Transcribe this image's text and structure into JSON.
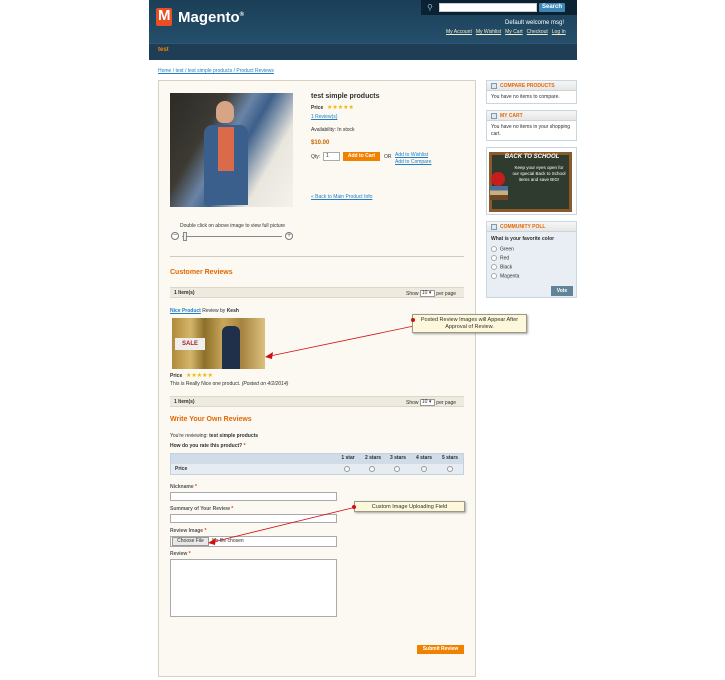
{
  "header": {
    "logo_letter": "M",
    "logo_text": "Magento",
    "logo_mark": "®",
    "search_button": "Search",
    "welcome": "Default welcome msg!",
    "links": [
      "My Account",
      "My Wishlist",
      "My Cart",
      "Checkout",
      "Log In"
    ],
    "nav_item": "test"
  },
  "breadcrumb": "Home / test / test simple products / Product Reviews",
  "product": {
    "name": "test simple products",
    "price_label": "Price",
    "stars": "★★★★★",
    "reviews_link": "1 Review(s)",
    "availability": "Availability: In stock",
    "price": "$10.00",
    "qty_label": "Qty:",
    "qty_value": "1",
    "add_to_cart": "Add to Cart",
    "or": "OR",
    "wishlist": "Add to Wishlist",
    "compare": "Add to Compare",
    "back_link": "« Back to Main Product Info",
    "zoom_hint": "Double click on above image to view full picture",
    "zoom_minus": "−",
    "zoom_plus": "+"
  },
  "reviews": {
    "title": "Customer Reviews",
    "items": "1 Item(s)",
    "show_label": "Show",
    "per_page_value": "10 ▾",
    "per_page_suffix": "per page",
    "review_title": "Nice Product",
    "review_by": " Review by ",
    "author": "Kesh",
    "sale_text": "SALE",
    "price_label": "Price",
    "stars": "★★★★★",
    "text": "This is Really Nice one product. ",
    "posted": "(Posted on 4/2/2014)"
  },
  "write": {
    "title": "Write Your Own Reviews",
    "reviewing_prefix": "You're reviewing: ",
    "reviewing_product": "test simple products",
    "rate_question": "How do you rate this product?",
    "required_mark": "*",
    "rating_headers": [
      "1 star",
      "2 stars",
      "3 stars",
      "4 stars",
      "5 stars"
    ],
    "rating_row": "Price",
    "nickname": "Nickname",
    "summary": "Summary of Your Review",
    "image": "Review Image",
    "choose_file": "Choose File",
    "no_file": "No file chosen",
    "review": "Review",
    "submit": "Submit Review"
  },
  "callouts": {
    "posted_images": "Posted Review Images will Appear After Approval of Review.",
    "upload_field": "Custom Image Uploading Field"
  },
  "sidebar": {
    "compare_title": "COMPARE PRODUCTS",
    "compare_text": "You have no items to compare.",
    "cart_title": "MY CART",
    "cart_text": "You have no items in your shopping cart.",
    "bts_title": "BACK TO SCHOOL",
    "bts_text": "Keep your eyes open for our special Back to School items and save BIG!",
    "poll_title": "COMMUNITY POLL",
    "poll_question": "What is your favorite color",
    "poll_options": [
      "Green",
      "Red",
      "Black",
      "Magenta"
    ],
    "vote": "Vote"
  },
  "colors": {
    "accent_orange": "#f18200",
    "link_blue": "#1e7ec8",
    "header_blue": "#1b3f57",
    "callout_arrow": "#d01010"
  }
}
